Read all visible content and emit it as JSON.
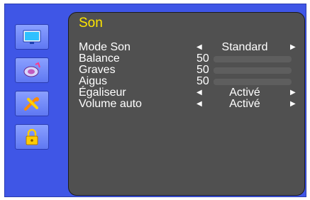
{
  "sidebar": {
    "items": [
      {
        "icon": "monitor-icon"
      },
      {
        "icon": "speaker-icon"
      },
      {
        "icon": "tools-icon"
      },
      {
        "icon": "lock-icon"
      }
    ]
  },
  "panel": {
    "title": "Son",
    "rows": [
      {
        "label": "Mode Son",
        "value": "Standard",
        "left_arrow": "◀",
        "right_arrow": "▶"
      },
      {
        "label": "Balance",
        "value": "50",
        "level": 0.5
      },
      {
        "label": "Graves",
        "value": "50",
        "level": 0.5
      },
      {
        "label": "Aigus",
        "value": "50",
        "level": 0.5
      },
      {
        "label": "Égaliseur",
        "value": "Activé",
        "left_arrow": "◀",
        "right_arrow": "▶"
      },
      {
        "label": "Volume auto",
        "value": "Activé",
        "left_arrow": "◀",
        "right_arrow": "▶"
      }
    ]
  },
  "colors": {
    "background": "#3f56e6",
    "panel": "#505050",
    "title": "#ffe600",
    "text": "#ffffff"
  }
}
